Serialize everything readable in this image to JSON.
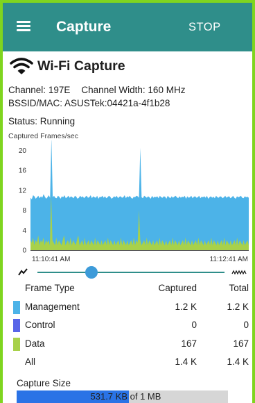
{
  "appbar": {
    "title": "Capture",
    "stop_label": "STOP",
    "color": "#2f8e8a"
  },
  "header": {
    "title": "Wi-Fi Capture"
  },
  "info": {
    "channel_label": "Channel:",
    "channel": "197E",
    "width_label": "Channel Width:",
    "width": "160 MHz",
    "bssid_label": "BSSID/MAC:",
    "bssid": "ASUSTek:04421a-4f1b28",
    "status_label": "Status:",
    "status": "Running"
  },
  "chart_data": {
    "type": "area",
    "title": "Captured Frames/sec",
    "ylim": [
      0,
      22
    ],
    "yticks": [
      0,
      4,
      8,
      12,
      16,
      20
    ],
    "x_start_label": "11:10:41 AM",
    "x_end_label": "11:12:41 AM",
    "series": [
      {
        "name": "Management",
        "color": "#4cb3e8",
        "values": [
          10.5,
          10.2,
          11.0,
          10.8,
          10.3,
          10.6,
          10.9,
          10.4,
          10.8,
          10.5,
          11.2,
          10.7,
          10.3,
          10.6,
          11.0,
          10.5,
          22.5,
          10.6,
          10.9,
          10.5,
          10.4,
          10.9,
          10.7,
          10.3,
          10.8,
          10.6,
          11.0,
          10.4,
          10.6,
          10.9,
          10.5,
          10.8,
          10.6,
          10.4,
          10.9,
          10.7,
          10.3,
          10.5,
          10.9,
          10.6,
          10.8,
          10.4,
          10.7,
          10.9,
          10.5,
          10.6,
          11.0,
          10.4,
          10.8,
          10.6,
          10.5,
          10.9,
          10.3,
          10.7,
          10.6,
          10.9,
          10.5,
          10.8,
          10.4,
          10.6,
          10.9,
          10.7,
          10.3,
          10.5,
          10.8,
          10.6,
          10.9,
          10.4,
          10.7,
          10.8,
          10.5,
          10.6,
          11.0,
          10.4,
          10.8,
          10.6,
          10.9,
          10.5,
          10.3,
          10.7,
          10.6,
          10.9,
          10.8,
          10.5,
          20.5,
          10.6,
          10.4,
          10.9,
          10.7,
          10.5,
          10.8,
          10.6,
          10.3,
          10.9,
          10.5,
          10.7,
          10.6,
          10.8,
          10.4,
          10.9,
          10.6,
          10.5,
          10.8,
          10.7,
          10.3,
          10.9,
          10.6,
          10.4,
          10.8,
          10.5,
          10.7,
          10.9,
          10.6,
          10.4,
          10.8,
          10.5,
          10.7,
          10.6,
          10.9,
          10.3,
          10.8,
          10.5,
          10.6,
          10.9,
          10.4,
          10.7,
          10.8,
          10.5,
          10.6,
          10.9,
          10.4,
          10.7,
          10.6,
          10.8,
          10.5,
          10.9,
          10.3,
          10.6,
          10.8,
          10.5,
          10.7,
          10.4,
          10.9,
          10.6,
          10.5,
          10.8,
          10.7,
          10.4,
          10.6,
          10.9,
          10.5,
          10.7,
          10.8,
          10.4,
          10.6,
          10.9,
          10.5,
          10.3,
          10.8,
          10.6,
          10.7,
          10.9,
          10.5,
          10.4,
          10.8,
          10.6,
          10.7,
          10.5
        ]
      },
      {
        "name": "Data",
        "color": "#a8d14a",
        "values": [
          2,
          1.5,
          2.5,
          1,
          2,
          1.5,
          3,
          1,
          2,
          1.5,
          2.5,
          1,
          2,
          1.5,
          2,
          1,
          11,
          2,
          1.5,
          1,
          2.5,
          1,
          2,
          1.5,
          1,
          2,
          3,
          1,
          1.5,
          2,
          1,
          2.5,
          1,
          2,
          1.5,
          1,
          2,
          3,
          1,
          1.5,
          2,
          1,
          2.5,
          1,
          1.5,
          2,
          1,
          2,
          1.5,
          1,
          2.5,
          1,
          2,
          1.5,
          1,
          2,
          1,
          1.5,
          2,
          1,
          2.5,
          1,
          2,
          1.5,
          1,
          2,
          1,
          1.5,
          2,
          1,
          2.5,
          1,
          2,
          1.5,
          1,
          2,
          1,
          1.5,
          2,
          1,
          2.5,
          1,
          2,
          1.5,
          8,
          2,
          1,
          1.5,
          2,
          1,
          2.5,
          1,
          2,
          1.5,
          1,
          2,
          1,
          1.5,
          2,
          1,
          2.5,
          1,
          2,
          1.5,
          1,
          2,
          1,
          1.5,
          2,
          1,
          2.5,
          1,
          2,
          1.5,
          1,
          2,
          1,
          1.5,
          2,
          1,
          2.5,
          1,
          2,
          1.5,
          1,
          2,
          1,
          1.5,
          2,
          1,
          2.5,
          1,
          2,
          1.5,
          1,
          2,
          1,
          1.5,
          2,
          1,
          2.5,
          1,
          2,
          1.5,
          1,
          2,
          1,
          1.5,
          2,
          1,
          2.5,
          1,
          2,
          1.5,
          1,
          2,
          1,
          1.5,
          2,
          1,
          2.5,
          1,
          2,
          1.5,
          1,
          2,
          1,
          1.5,
          2,
          1
        ]
      }
    ]
  },
  "table": {
    "headers": [
      "Frame Type",
      "Captured",
      "Total"
    ],
    "rows": [
      {
        "type": "Management",
        "captured": "1.2 K",
        "total": "1.2 K",
        "color": "#4cb3e8"
      },
      {
        "type": "Control",
        "captured": "0",
        "total": "0",
        "color": "#5865e8"
      },
      {
        "type": "Data",
        "captured": "167",
        "total": "167",
        "color": "#a8d14a"
      },
      {
        "type": "All",
        "captured": "1.4 K",
        "total": "1.4 K",
        "color": ""
      }
    ]
  },
  "capture": {
    "label": "Capture Size",
    "value": "531.7 KB",
    "of_text": "of 1 MB",
    "fraction": 0.532
  },
  "slider_position": 0.29
}
